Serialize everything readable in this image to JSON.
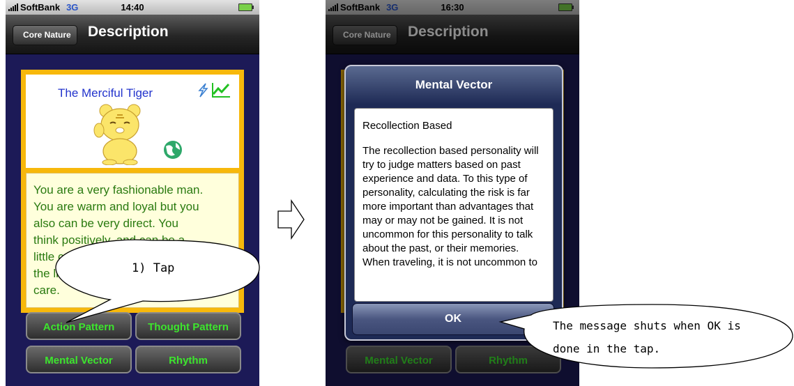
{
  "left_screen": {
    "status": {
      "carrier": "SoftBank",
      "network": "3G",
      "time": "14:40"
    },
    "nav": {
      "back_label": "Core Nature",
      "title": "Description"
    },
    "type_name": "The Merciful Tiger",
    "description": "You are a very fashionable man. You are warm and loyal but you also can be very direct. You think positively, and can be a little c... the li... care.",
    "desc_lines": [
      "You are a very fashionable man.",
      "You are warm and loyal but you",
      "also can be very direct.  You",
      "think positively, and can be a",
      "little c",
      "the li",
      "care."
    ],
    "buttons": {
      "action": "Action Pattern",
      "thought": "Thought Pattern",
      "mental": "Mental Vector",
      "rhythm": "Rhythm"
    }
  },
  "right_screen": {
    "status": {
      "carrier": "SoftBank",
      "network": "3G",
      "time": "16:30"
    },
    "nav": {
      "back_label": "Core Nature",
      "title": "Description"
    },
    "alert": {
      "title": "Mental Vector",
      "heading": "Recollection Based",
      "body": "The recollection based personality will try to judge matters based on past experience and data.  To this type of personality, calculating the risk is far more important than advantages that may or may not be gained.  It is not uncommon for this personality to talk about the past, or their memories.  When traveling, it is not uncommon to",
      "ok_label": "OK"
    },
    "buttons": {
      "mental": "Mental Vector",
      "rhythm": "Rhythm"
    }
  },
  "annotations": {
    "tap": "1) Tap",
    "ok_note_line1": "The message shuts when OK is",
    "ok_note_line2": "done in the tap."
  }
}
